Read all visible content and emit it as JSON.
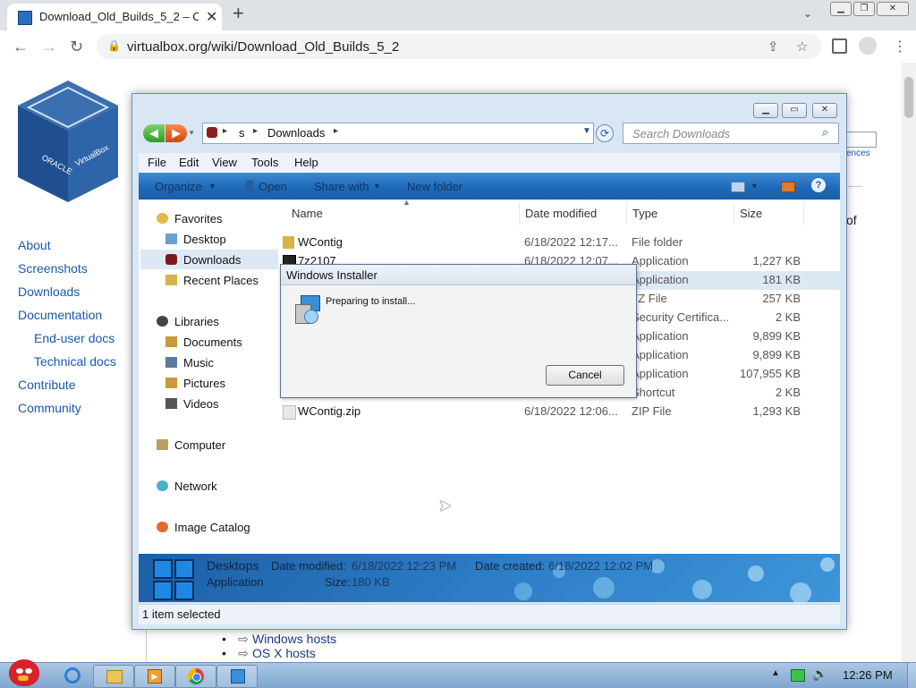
{
  "browser": {
    "tab_title": "Download_Old_Builds_5_2 – O",
    "url": "virtualbox.org/wiki/Download_Old_Builds_5_2",
    "new_tab_glyph": "+",
    "tab_close_glyph": "✕"
  },
  "site": {
    "nav": [
      "About",
      "Screenshots",
      "Downloads",
      "Documentation",
      "End-user docs",
      "Technical docs",
      "Contribute",
      "Community"
    ],
    "right_snippet_1": "ences",
    "right_snippet_2": "of",
    "list_items": [
      "Windows hosts",
      "OS X hosts"
    ],
    "logo_text": [
      "ORACLE",
      "VirtualBox"
    ]
  },
  "explorer": {
    "breadcrumb": [
      "s",
      "Downloads"
    ],
    "search_placeholder": "Search Downloads",
    "menu": [
      "File",
      "Edit",
      "View",
      "Tools",
      "Help"
    ],
    "commands": {
      "organize": "Organize",
      "open": "Open",
      "share": "Share with",
      "new_folder": "New folder"
    },
    "nav_groups": {
      "favorites": {
        "label": "Favorites",
        "items": [
          "Desktop",
          "Downloads",
          "Recent Places"
        ]
      },
      "libraries": {
        "label": "Libraries",
        "items": [
          "Documents",
          "Music",
          "Pictures",
          "Videos"
        ]
      },
      "computer": "Computer",
      "network": "Network",
      "catalog": "Image Catalog"
    },
    "columns": [
      "Name",
      "Date modified",
      "Type",
      "Size"
    ],
    "files": [
      {
        "name": "WContig",
        "date": "6/18/2022 12:17...",
        "type": "File folder",
        "size": ""
      },
      {
        "name": "7z2107",
        "date": "6/18/2022 12:07...",
        "type": "Application",
        "size": "1,227 KB"
      },
      {
        "name": "",
        "date": "",
        "type": "Application",
        "size": "181 KB"
      },
      {
        "name": "",
        "date": "",
        "type": "7Z File",
        "size": "257 KB"
      },
      {
        "name": "",
        "date": "",
        "type": "Security Certifica...",
        "size": "2 KB"
      },
      {
        "name": "",
        "date": "",
        "type": "Application",
        "size": "9,899 KB"
      },
      {
        "name": "",
        "date": "",
        "type": "Application",
        "size": "9,899 KB"
      },
      {
        "name": "",
        "date": "",
        "type": "Application",
        "size": "107,955 KB"
      },
      {
        "name": "",
        "date": "",
        "type": "Shortcut",
        "size": "2 KB"
      },
      {
        "name": "WContig.zip",
        "date": "6/18/2022 12:06...",
        "type": "ZIP File",
        "size": "1,293 KB"
      }
    ],
    "details": {
      "name": "Desktops",
      "kind": "Application",
      "modified_label": "Date modified:",
      "modified_value": "6/18/2022 12:23 PM",
      "created_label": "Date created:",
      "created_value": "6/18/2022 12:02 PM",
      "size_label": "Size:",
      "size_value": "180 KB"
    },
    "status": "1 item selected"
  },
  "installer": {
    "title": "Windows Installer",
    "message": "Preparing to install...",
    "cancel": "Cancel"
  },
  "taskbar": {
    "clock": "12:26 PM"
  },
  "colors": {
    "link": "#1a58a8",
    "command_bar": "#1e6ab8",
    "selection": "#dde8f5"
  }
}
